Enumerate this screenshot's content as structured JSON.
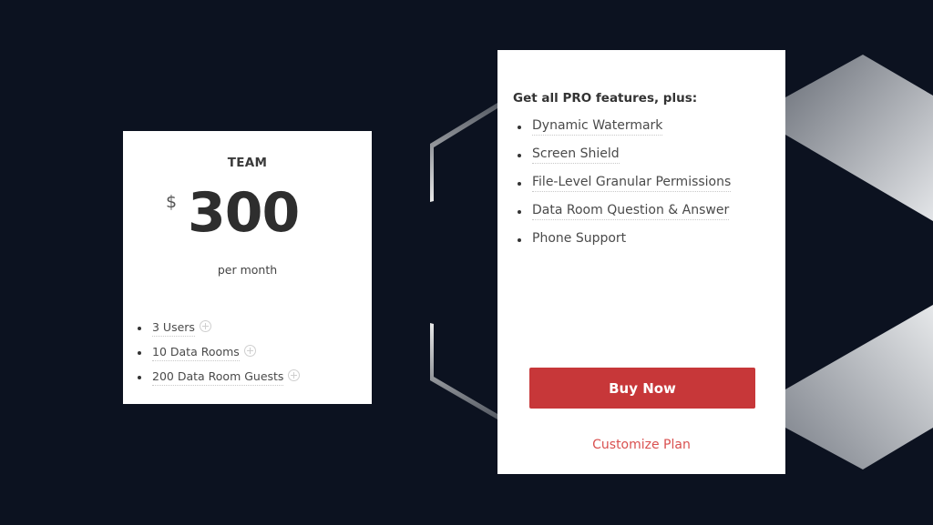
{
  "team_plan": {
    "name": "TEAM",
    "currency": "$",
    "price": "300",
    "period": "per month",
    "features": [
      {
        "label": "3 Users",
        "icon": "plus-circle-icon"
      },
      {
        "label": "10 Data Rooms",
        "icon": "plus-circle-icon"
      },
      {
        "label": "200 Data Room Guests",
        "icon": "plus-circle-icon"
      }
    ]
  },
  "pro_plan": {
    "heading": "Get all PRO features, plus:",
    "features": [
      {
        "label": "Dynamic Watermark"
      },
      {
        "label": "Screen Shield"
      },
      {
        "label": "File-Level Granular Permissions"
      },
      {
        "label": "Data Room Question & Answer"
      },
      {
        "label": "Phone Support"
      }
    ],
    "buy_label": "Buy Now",
    "customize_label": "Customize Plan"
  },
  "colors": {
    "background": "#0c1220",
    "accent": "#c73739",
    "link": "#d9504f"
  }
}
